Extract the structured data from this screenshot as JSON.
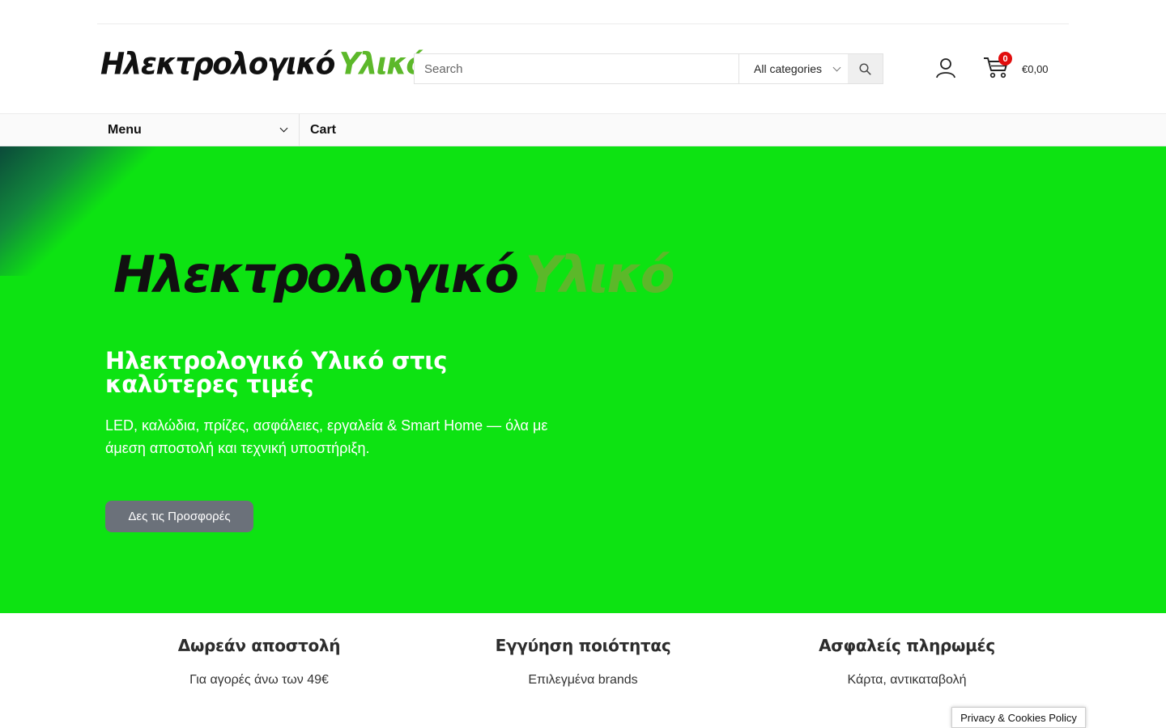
{
  "brand": {
    "word1": "Ηλεκτρολογικό",
    "word2": "Υλικό"
  },
  "search": {
    "placeholder": "Search",
    "category": "All categories"
  },
  "cart": {
    "count": "0",
    "total": "€0,00"
  },
  "nav": {
    "menu_label": "Menu",
    "cart_label": "Cart"
  },
  "hero": {
    "logo_word1": "Ηλεκτρολογικό",
    "logo_word2": "Υλικό",
    "title": "Ηλεκτρολογικό Υλικό στις καλύτερες τιμές",
    "subtitle": "LED, καλώδια, πρίζες, ασφάλειες, εργαλεία & Smart Home — όλα με άμεση αποστολή και τεχνική υποστήριξη.",
    "button": "Δες τις Προσφορές"
  },
  "features": [
    {
      "title": "Δωρεάν αποστολή",
      "text": "Για αγορές άνω των 49€"
    },
    {
      "title": "Εγγύηση ποιότητας",
      "text": "Επιλεγμένα brands"
    },
    {
      "title": "Ασφαλείς πληρωμές",
      "text": "Κάρτα, αντικαταβολή"
    }
  ],
  "privacy": {
    "label": "Privacy & Cookies Policy"
  },
  "colors": {
    "hero_bg": "#0de312",
    "brand_green": "#5cb82a",
    "badge_red": "#e10d0d",
    "button_gray": "#6b717a"
  },
  "icons": {
    "search": "search-icon",
    "account": "user-icon",
    "cart": "cart-icon",
    "dropdown": "chevron-down-icon"
  }
}
